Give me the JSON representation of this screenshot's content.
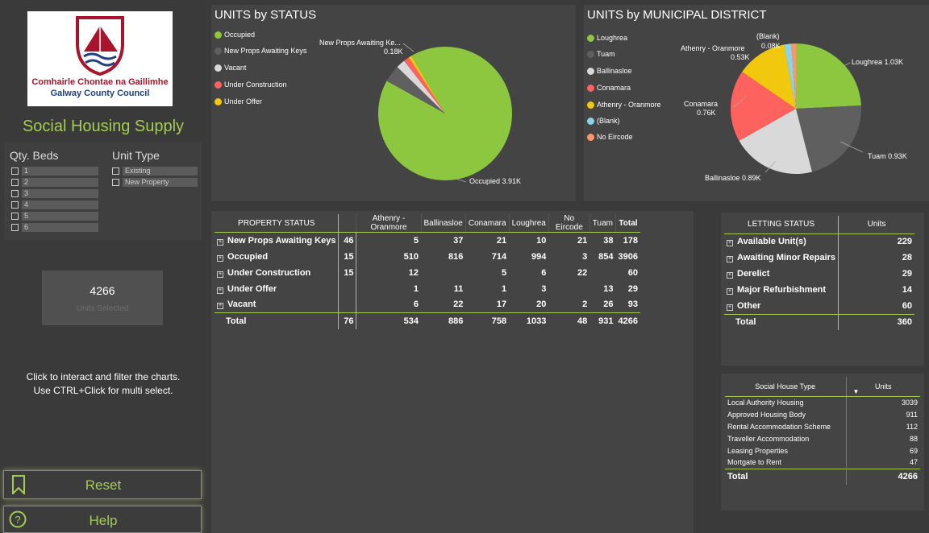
{
  "sidebar": {
    "logo": {
      "line1": "Comhairle Chontae na Gaillimhe",
      "line2": "Galway County Council"
    },
    "title": "Social Housing Supply",
    "qty_beds": {
      "label": "Qty. Beds",
      "items": [
        "1",
        "2",
        "3",
        "4",
        "5",
        "6"
      ]
    },
    "unit_type": {
      "label": "Unit Type",
      "items": [
        "Existing",
        "New Property"
      ]
    },
    "card": {
      "value": "4266",
      "label": "Units Selected"
    },
    "hint_line1": "Click to interact and filter the charts.",
    "hint_line2": "Use CTRL+Click for multi select.",
    "reset_label": "Reset",
    "help_label": "Help"
  },
  "colors": {
    "accent": "#a5cc52",
    "occupied": "#8dc63f",
    "new_props": "#5f5f5f",
    "vacant": "#d9d9d9",
    "under_construction": "#fd625e",
    "under_offer": "#f2c80f",
    "blank": "#8ad4eb",
    "no_eircode": "#fe9666"
  },
  "status_chart": {
    "title": "UNITS by STATUS",
    "legend": [
      "Occupied",
      "New Props Awaiting Keys",
      "Vacant",
      "Under Construction",
      "Under Offer"
    ],
    "label_new_props_name": "New Props Awaiting Ke...",
    "label_new_props_val": "0.18K",
    "label_occupied": "Occupied 3.91K"
  },
  "district_chart": {
    "title": "UNITS by MUNICIPAL DISTRICT",
    "legend": [
      "Loughrea",
      "Tuam",
      "Ballinasloe",
      "Conamara",
      "Athenry - Oranmore",
      "(Blank)",
      "No Eircode"
    ],
    "labels": {
      "blank_name": "(Blank)",
      "blank_val": "0.08K",
      "athenry_name": "Athenry - Oranmore",
      "athenry_val": "0.53K",
      "loughrea": "Loughrea 1.03K",
      "conamara_name": "Conamara",
      "conamara_val": "0.76K",
      "tuam": "Tuam 0.93K",
      "ballinasloe": "Ballinasloe 0.89K"
    }
  },
  "chart_data": [
    {
      "type": "pie",
      "title": "UNITS by STATUS",
      "categories": [
        "Occupied",
        "New Props Awaiting Keys",
        "Vacant",
        "Under Construction",
        "Under Offer"
      ],
      "values": [
        3906,
        178,
        93,
        60,
        29
      ]
    },
    {
      "type": "pie",
      "title": "UNITS by MUNICIPAL DISTRICT",
      "categories": [
        "Loughrea",
        "Tuam",
        "Ballinasloe",
        "Conamara",
        "Athenry - Oranmore",
        "(Blank)",
        "No Eircode"
      ],
      "values": [
        1033,
        931,
        886,
        758,
        534,
        76,
        48
      ]
    }
  ],
  "property_table": {
    "headers": [
      "PROPERTY STATUS",
      "",
      "Athenry - Oranmore",
      "Ballinasloe",
      "Conamara",
      "Loughrea",
      "No Eircode",
      "Tuam",
      "Total"
    ],
    "rows": [
      [
        "New Props Awaiting Keys",
        "46",
        "5",
        "37",
        "21",
        "10",
        "21",
        "38",
        "178"
      ],
      [
        "Occupied",
        "15",
        "510",
        "816",
        "714",
        "994",
        "3",
        "854",
        "3906"
      ],
      [
        "Under Construction",
        "15",
        "12",
        "",
        "5",
        "6",
        "22",
        "",
        "60"
      ],
      [
        "Under Offer",
        "",
        "1",
        "11",
        "1",
        "3",
        "",
        "13",
        "29"
      ],
      [
        "Vacant",
        "",
        "6",
        "22",
        "17",
        "20",
        "2",
        "26",
        "93"
      ]
    ],
    "total": [
      "Total",
      "76",
      "534",
      "886",
      "758",
      "1033",
      "48",
      "931",
      "4266"
    ]
  },
  "letting_table": {
    "headers": [
      "LETTING STATUS",
      "Units"
    ],
    "rows": [
      [
        "Available Unit(s)",
        "229"
      ],
      [
        "Awaiting Minor Repairs",
        "28"
      ],
      [
        "Derelict",
        "29"
      ],
      [
        "Major Refurbishment",
        "14"
      ],
      [
        "Other",
        "60"
      ]
    ],
    "total": [
      "Total",
      "360"
    ]
  },
  "house_type_table": {
    "headers": [
      "Social House Type",
      "Units"
    ],
    "rows": [
      [
        "Local Authority Housing",
        "3039"
      ],
      [
        "Approved Housing Body",
        "911"
      ],
      [
        "Rental Accommodation Scheme",
        "112"
      ],
      [
        "Traveller Accommodation",
        "88"
      ],
      [
        "Leasing Properties",
        "69"
      ],
      [
        "Mortgate to Rent",
        "47"
      ]
    ],
    "total": [
      "Total",
      "4266"
    ]
  }
}
